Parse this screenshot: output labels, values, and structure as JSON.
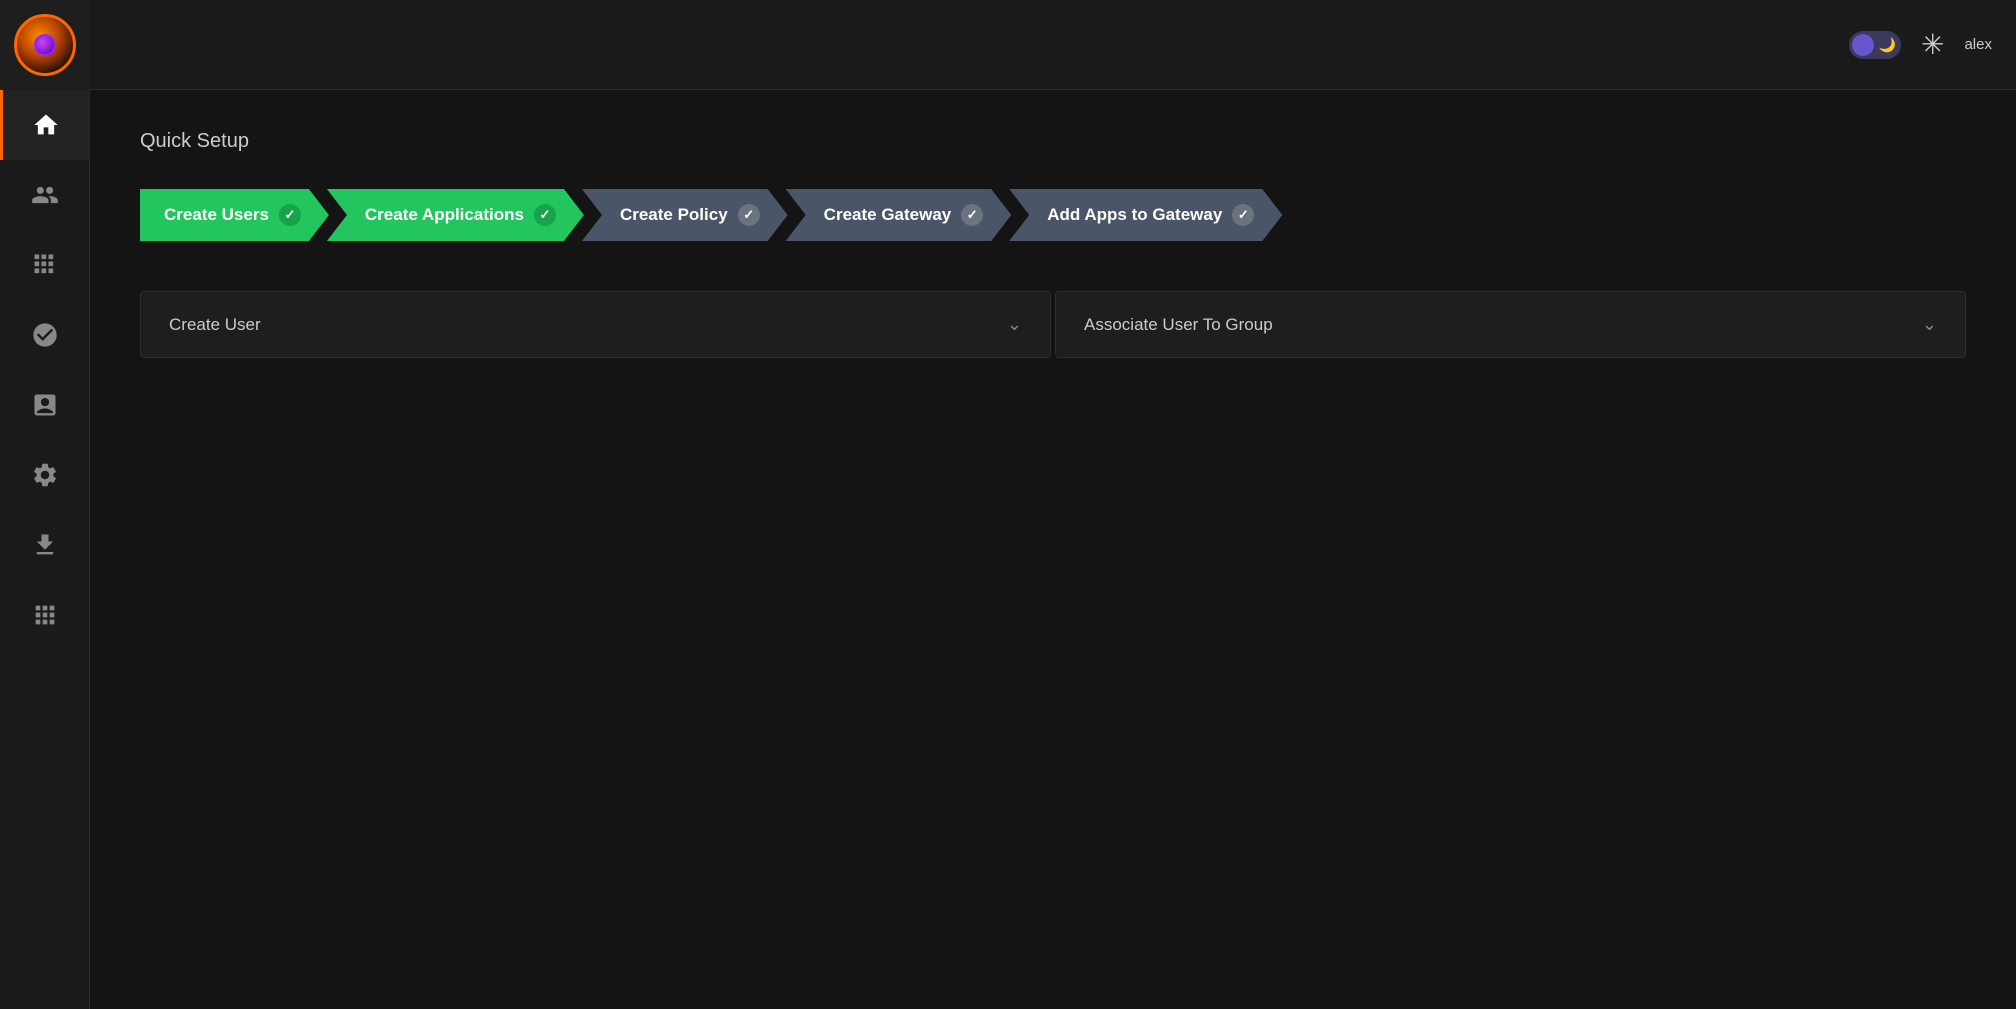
{
  "header": {
    "user_label": "alex"
  },
  "sidebar": {
    "items": [
      {
        "id": "home",
        "icon": "home",
        "active": true
      },
      {
        "id": "users-list",
        "icon": "users-list",
        "active": false
      },
      {
        "id": "grid-apps",
        "icon": "grid-apps",
        "active": false
      },
      {
        "id": "user-roles",
        "icon": "user-roles",
        "active": false
      },
      {
        "id": "policies",
        "icon": "policies",
        "active": false
      },
      {
        "id": "settings-list",
        "icon": "settings-list",
        "active": false
      },
      {
        "id": "download",
        "icon": "download",
        "active": false
      },
      {
        "id": "add-apps",
        "icon": "add-apps",
        "active": false
      }
    ]
  },
  "main": {
    "quick_setup_title": "Quick Setup",
    "steps": [
      {
        "id": "create-users",
        "label": "Create Users",
        "status": "green",
        "checked": true
      },
      {
        "id": "create-applications",
        "label": "Create Applications",
        "status": "green",
        "checked": true
      },
      {
        "id": "create-policy",
        "label": "Create Policy",
        "status": "grey",
        "checked": true
      },
      {
        "id": "create-gateway",
        "label": "Create Gateway",
        "status": "grey",
        "checked": true
      },
      {
        "id": "add-apps-gateway",
        "label": "Add Apps to Gateway",
        "status": "grey",
        "checked": true
      }
    ],
    "accordion": {
      "create_user": {
        "label": "Create User",
        "expanded": false
      },
      "associate_user": {
        "label": "Associate User To Group",
        "expanded": false
      }
    }
  }
}
